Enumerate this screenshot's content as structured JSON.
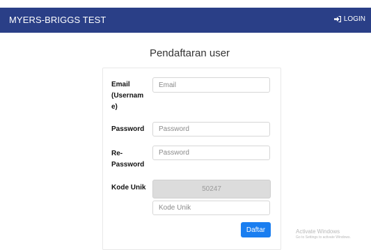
{
  "navbar": {
    "brand": "MYERS-BRIGGS TEST",
    "login_icon": "sign-in-icon",
    "login_label": "LOGIN"
  },
  "page": {
    "title": "Pendaftaran user"
  },
  "form": {
    "email": {
      "label": "Email (Username)",
      "label_lines": [
        "Email",
        "(Usernam",
        "e)"
      ],
      "placeholder": "Email",
      "value": ""
    },
    "password": {
      "label": "Password",
      "placeholder": "Password",
      "value": ""
    },
    "repassword": {
      "label_lines": [
        "Re-",
        "Password"
      ],
      "placeholder": "Password",
      "value": ""
    },
    "code": {
      "label": "Kode Unik",
      "display_value": "50247",
      "placeholder": "Kode Unik",
      "value": ""
    },
    "submit_label": "Daftar"
  },
  "watermark": {
    "title": "Activate Windows",
    "subtitle": "Go to Settings to activate Windows."
  },
  "colors": {
    "navbar": "#2a3f87",
    "button": "#1a7ef0",
    "code_box": "#dcdcdc"
  }
}
